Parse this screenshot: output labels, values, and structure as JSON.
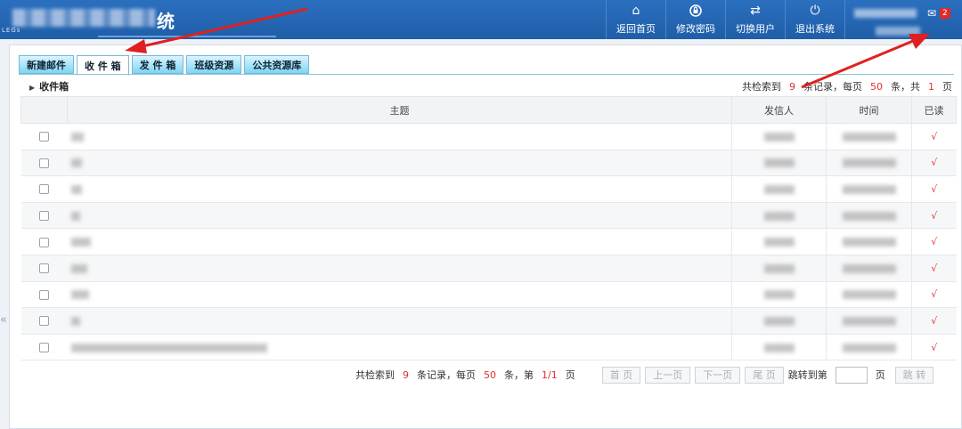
{
  "header": {
    "title_char": "统",
    "nav": [
      {
        "label": "返回首页",
        "icon": "home-icon",
        "glyph": "⌂"
      },
      {
        "label": "修改密码",
        "icon": "lock-icon",
        "glyph": "🔒"
      },
      {
        "label": "切换用户",
        "icon": "switch-arrows-icon",
        "glyph": "⇄"
      },
      {
        "label": "退出系统",
        "icon": "power-icon",
        "glyph": "⏻"
      }
    ],
    "mail_badge": "2"
  },
  "tabs": [
    {
      "label": "新建邮件"
    },
    {
      "label": "收 件 箱"
    },
    {
      "label": "发 件 箱"
    },
    {
      "label": "班级资源"
    },
    {
      "label": "公共资源库"
    }
  ],
  "breadcrumb": "收件箱",
  "summary": {
    "prefix": "共检索到",
    "total": "9",
    "mid": "条记录，每页",
    "per_page": "50",
    "suffix1": "条，共",
    "pages": "1",
    "suffix2": "页"
  },
  "table": {
    "headers": {
      "subject": "主题",
      "sender": "发信人",
      "time": "时间",
      "read": "已读"
    },
    "rows": [
      {
        "read": "√"
      },
      {
        "read": "√"
      },
      {
        "read": "√"
      },
      {
        "read": "√"
      },
      {
        "read": "√"
      },
      {
        "read": "√"
      },
      {
        "read": "√"
      },
      {
        "read": "√"
      },
      {
        "read": "√"
      }
    ]
  },
  "pager": {
    "prefix": "共检索到",
    "total": "9",
    "mid": "条记录，每页",
    "per_page": "50",
    "suffix1": "条，第",
    "current": "1/1",
    "suffix2": "页",
    "first": "首 页",
    "prev": "上一页",
    "next": "下一页",
    "last": "尾 页",
    "jump_label": "跳转到第",
    "jump_suffix": "页",
    "jump_button": "跳 转"
  },
  "colors": {
    "header": "#1f5ea8",
    "accent_red": "#e03030",
    "tab": "#7fd6f3"
  },
  "collapse_glyph": "«"
}
